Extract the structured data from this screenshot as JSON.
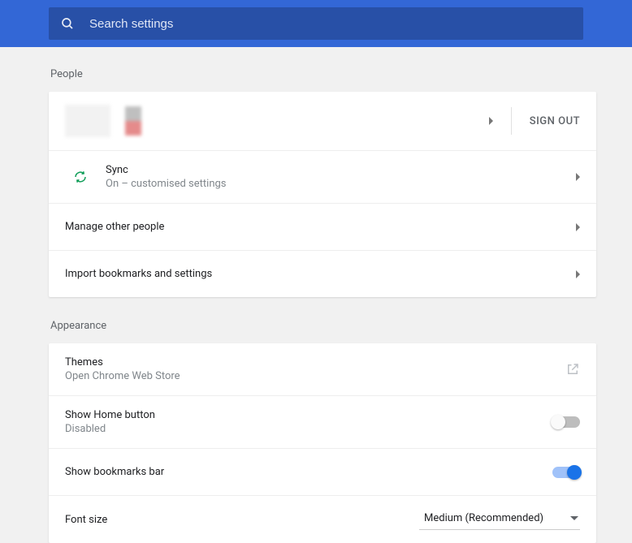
{
  "search": {
    "placeholder": "Search settings"
  },
  "sections": {
    "people": {
      "title": "People",
      "signout": "SIGN OUT",
      "sync": {
        "title": "Sync",
        "sub": "On – customised settings"
      },
      "manage": "Manage other people",
      "import": "Import bookmarks and settings"
    },
    "appearance": {
      "title": "Appearance",
      "themes": {
        "title": "Themes",
        "sub": "Open Chrome Web Store"
      },
      "home": {
        "title": "Show Home button",
        "sub": "Disabled",
        "on": false
      },
      "bookmarks": {
        "title": "Show bookmarks bar",
        "on": true
      },
      "font": {
        "title": "Font size",
        "value": "Medium (Recommended)"
      }
    }
  }
}
